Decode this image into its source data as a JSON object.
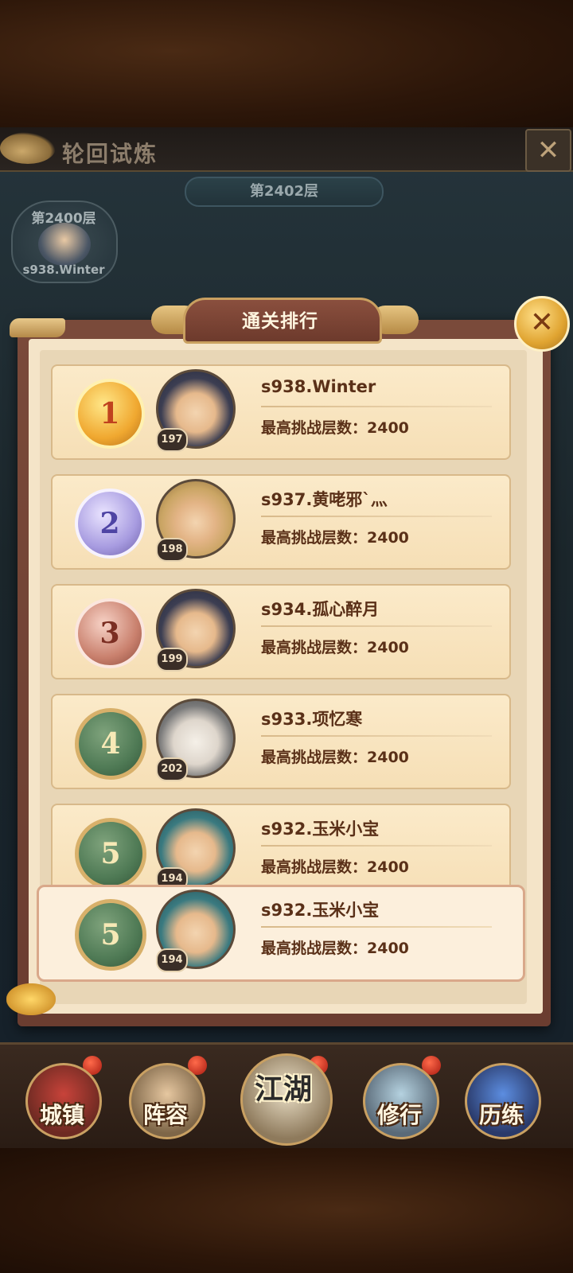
{
  "header": {
    "title": "轮回试炼",
    "current_floor": "第2402层",
    "close_icon": "x-icon"
  },
  "top_record": {
    "floor": "第2400层",
    "name": "s938.Winter"
  },
  "modal": {
    "title": "通关排行",
    "label_prefix": "最高挑战层数：",
    "rows": [
      {
        "rank": "1",
        "level": "197",
        "name": "s938.Winter",
        "best": "2400",
        "medal": "gold"
      },
      {
        "rank": "2",
        "level": "198",
        "name": "s937.黄咾邪`灬",
        "best": "2400",
        "medal": "silver"
      },
      {
        "rank": "3",
        "level": "199",
        "name": "s934.孤心醉月",
        "best": "2400",
        "medal": "bronze"
      },
      {
        "rank": "4",
        "level": "202",
        "name": "s933.项忆寒",
        "best": "2400",
        "medal": "plain"
      },
      {
        "rank": "5",
        "level": "194",
        "name": "s932.玉米小宝",
        "best": "2400",
        "medal": "plain"
      }
    ],
    "my_row": {
      "rank": "5",
      "level": "194",
      "name": "s932.玉米小宝",
      "best": "2400"
    }
  },
  "nav": {
    "items": [
      "城镇",
      "阵容",
      "江湖",
      "修行",
      "历练"
    ]
  },
  "colors": {
    "modal_frame": "#7a4a3a",
    "row_bg": "#fbeac9",
    "text_brown": "#5a3018",
    "gold": "#e0a431"
  }
}
